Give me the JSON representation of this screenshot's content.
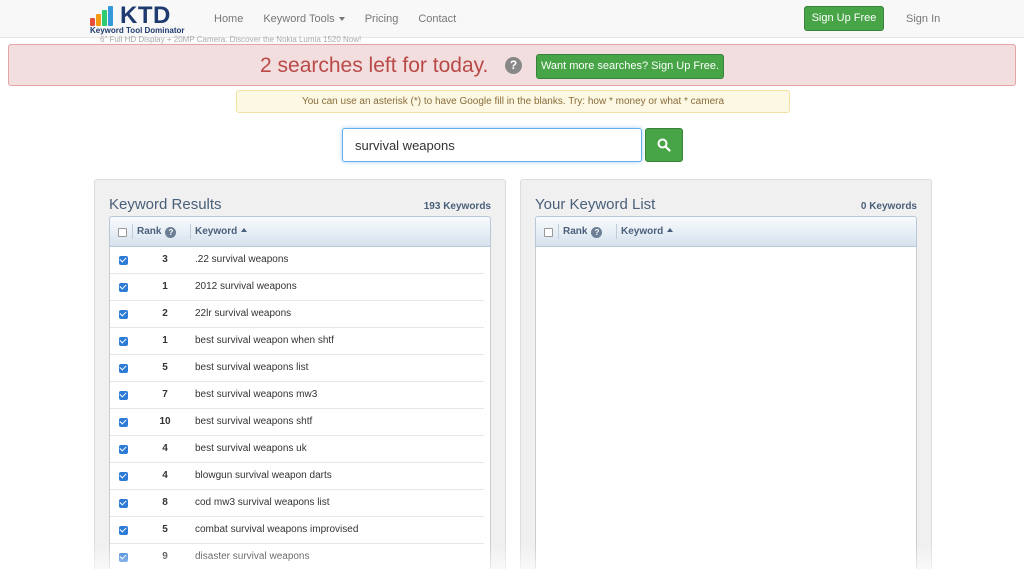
{
  "nav": {
    "logo_text": "KTD",
    "logo_sub": "Keyword Tool Dominator",
    "links": [
      "Home",
      "Keyword Tools",
      "Pricing",
      "Contact"
    ],
    "signup_label": "Sign Up Free",
    "signin_label": "Sign In"
  },
  "ticker": "6\" Full HD Display + 20MP Camera. Discover the Nokia Lumia 1520 Now!",
  "alert": {
    "message": "2 searches left for today.",
    "help": "?",
    "button_label": "Want more searches? Sign Up Free."
  },
  "tip": "You can use an asterisk (*) to have Google fill in the blanks. Try: how * money or what * camera",
  "search": {
    "value": "survival weapons"
  },
  "results": {
    "title": "Keyword Results",
    "count": "193 Keywords",
    "col_rank": "Rank",
    "col_keyword": "Keyword",
    "rows": [
      {
        "rank": "3",
        "keyword": ".22 survival weapons"
      },
      {
        "rank": "1",
        "keyword": "2012 survival weapons"
      },
      {
        "rank": "2",
        "keyword": "22lr survival weapons"
      },
      {
        "rank": "1",
        "keyword": "best survival weapon when shtf"
      },
      {
        "rank": "5",
        "keyword": "best survival weapons list"
      },
      {
        "rank": "7",
        "keyword": "best survival weapons mw3"
      },
      {
        "rank": "10",
        "keyword": "best survival weapons shtf"
      },
      {
        "rank": "4",
        "keyword": "best survival weapons uk"
      },
      {
        "rank": "4",
        "keyword": "blowgun survival weapon darts"
      },
      {
        "rank": "8",
        "keyword": "cod mw3 survival weapons list"
      },
      {
        "rank": "5",
        "keyword": "combat survival weapons improvised"
      },
      {
        "rank": "9",
        "keyword": "disaster survival weapons"
      }
    ]
  },
  "list": {
    "title": "Your Keyword List",
    "count": "0 Keywords",
    "col_rank": "Rank",
    "col_keyword": "Keyword"
  },
  "colors": {
    "brand_green": "#47a447",
    "alert_red": "#b94a48",
    "header_blue": "#4a5f7a",
    "check_blue": "#2e7bd6"
  }
}
